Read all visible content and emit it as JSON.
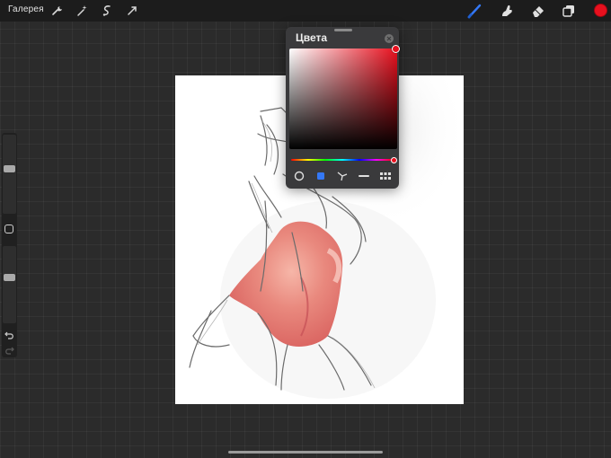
{
  "topbar": {
    "gallery_label": "Галерея",
    "left_tools": [
      {
        "icon": "wrench-icon"
      },
      {
        "icon": "magic-wand-icon"
      },
      {
        "icon": "selection-icon"
      },
      {
        "icon": "transform-icon"
      }
    ],
    "right_tools": [
      {
        "icon": "brush-icon"
      },
      {
        "icon": "smudge-icon"
      },
      {
        "icon": "eraser-icon"
      },
      {
        "icon": "layers-icon"
      }
    ],
    "current_color": "#e8101e"
  },
  "sidebar": {
    "brush_size_level": 0.42,
    "opacity_level": 0.4,
    "modify_icon": "square-modify-icon",
    "undo_icon": "undo-icon",
    "redo_icon": "redo-icon"
  },
  "colors_panel": {
    "title": "Цвета",
    "selected_color": "#e8101e",
    "modes": [
      {
        "icon": "disc-mode-icon",
        "active": false
      },
      {
        "icon": "classic-mode-icon",
        "active": true
      },
      {
        "icon": "harmony-mode-icon",
        "active": false
      },
      {
        "icon": "value-mode-icon",
        "active": false
      },
      {
        "icon": "palettes-mode-icon",
        "active": false
      }
    ]
  },
  "colors": {
    "accent_blue": "#3478f6",
    "background": "#2b2b2b"
  }
}
